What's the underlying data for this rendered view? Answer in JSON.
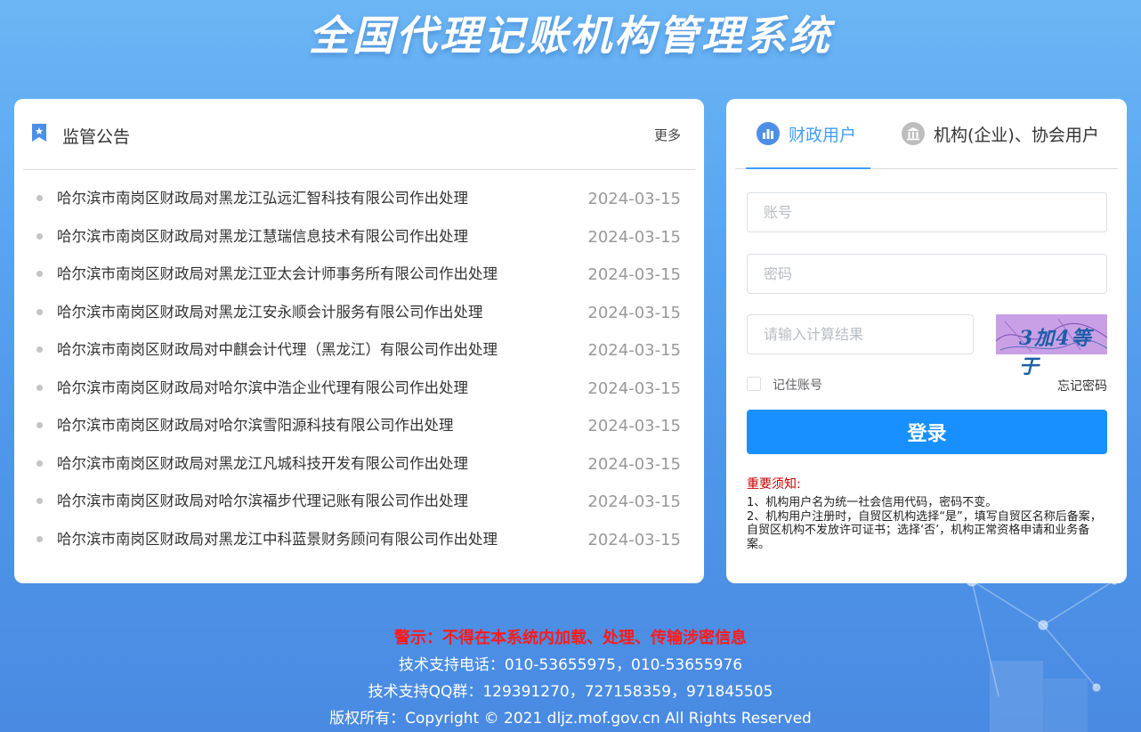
{
  "header": {
    "title": "全国代理记账机构管理系统"
  },
  "announcements": {
    "title": "监管公告",
    "more_label": "更多",
    "items": [
      {
        "text": "哈尔滨市南岗区财政局对黑龙江弘远汇智科技有限公司作出处理",
        "date": "2024-03-15"
      },
      {
        "text": "哈尔滨市南岗区财政局对黑龙江慧瑞信息技术有限公司作出处理",
        "date": "2024-03-15"
      },
      {
        "text": "哈尔滨市南岗区财政局对黑龙江亚太会计师事务所有限公司作出处理",
        "date": "2024-03-15"
      },
      {
        "text": "哈尔滨市南岗区财政局对黑龙江安永顺会计服务有限公司作出处理",
        "date": "2024-03-15"
      },
      {
        "text": "哈尔滨市南岗区财政局对中麒会计代理（黑龙江）有限公司作出处理",
        "date": "2024-03-15"
      },
      {
        "text": "哈尔滨市南岗区财政局对哈尔滨中浩企业代理有限公司作出处理",
        "date": "2024-03-15"
      },
      {
        "text": "哈尔滨市南岗区财政局对哈尔滨雪阳源科技有限公司作出处理",
        "date": "2024-03-15"
      },
      {
        "text": "哈尔滨市南岗区财政局对黑龙江凡城科技开发有限公司作出处理",
        "date": "2024-03-15"
      },
      {
        "text": "哈尔滨市南岗区财政局对哈尔滨福步代理记账有限公司作出处理",
        "date": "2024-03-15"
      },
      {
        "text": "哈尔滨市南岗区财政局对黑龙江中科蓝景财务顾问有限公司作出处理",
        "date": "2024-03-15"
      }
    ]
  },
  "login": {
    "tabs": [
      {
        "label": "财政用户",
        "active": true,
        "icon": "chart-icon"
      },
      {
        "label": "机构(企业)、协会用户",
        "active": false,
        "icon": "bank-icon"
      }
    ],
    "account_placeholder": "账号",
    "password_placeholder": "密码",
    "captcha_placeholder": "请输入计算结果",
    "captcha_text": "3加4等于",
    "remember_label": "记住账号",
    "forgot_label": "忘记密码",
    "submit_label": "登录",
    "notice_title": "重要须知:",
    "notice_lines": [
      "1、机构用户名为统一社会信用代码，密码不变。",
      "2、机构用户注册时，自贸区机构选择“是”，填写自贸区名称后备案，自贸区机构不发放许可证书；选择‘否’，机构正常资格申请和业务备案。"
    ]
  },
  "footer": {
    "warning": "警示：不得在本系统内加载、处理、传输涉密信息",
    "phone": "技术支持电话：010-53655975，010-53655976",
    "qq": "技术支持QQ群：129391270，727158359，971845505",
    "copyright": "版权所有：Copyright © 2021 dljz.mof.gov.cn All Rights Reserved"
  },
  "colors": {
    "accent": "#409eff",
    "button": "#1890ff",
    "warning": "#ff1a1a",
    "notice_title": "#cc0000"
  }
}
